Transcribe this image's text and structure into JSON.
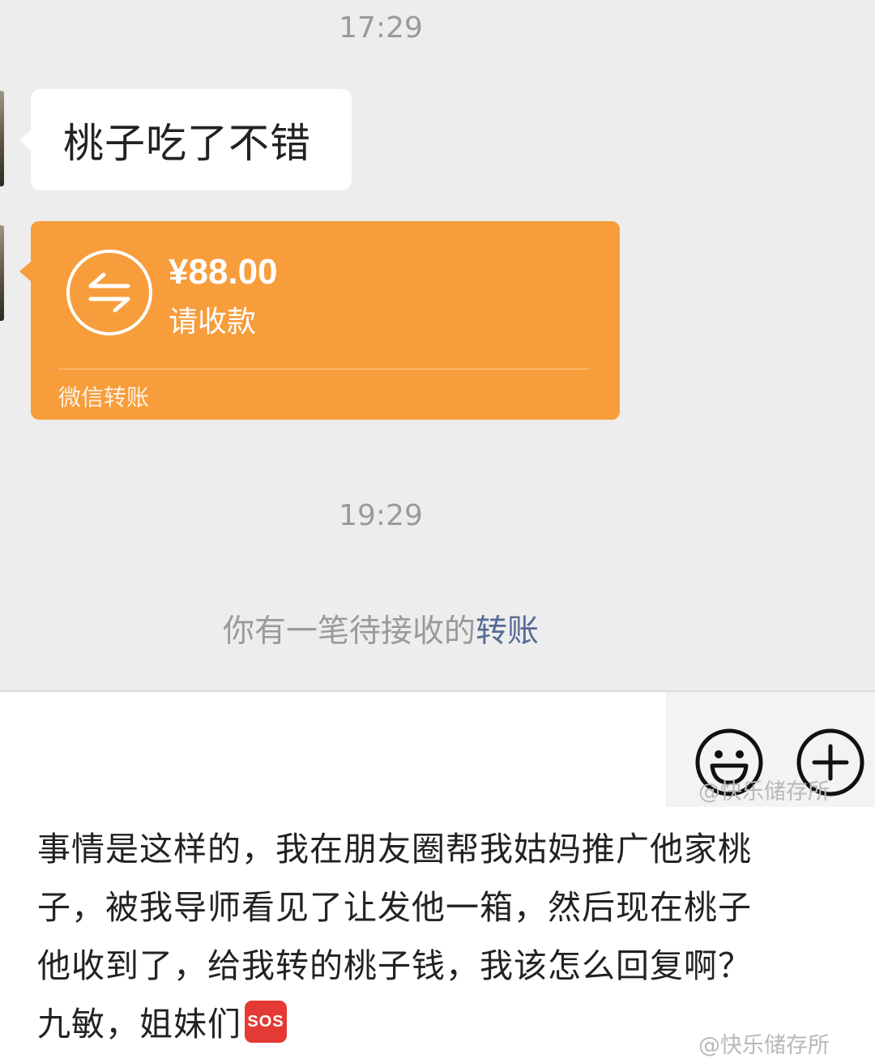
{
  "chat": {
    "timestamp_1": "17:29",
    "message_1": "桃子吃了不错",
    "transfer": {
      "amount": "¥88.00",
      "status": "请收款",
      "footer": "微信转账",
      "color": "#f79d3b"
    },
    "timestamp_2": "19:29",
    "notice_prefix": "你有一笔待接收的",
    "notice_link": "转账",
    "link_color": "#576b95"
  },
  "input_bar": {
    "emoji_icon": "smiley-face-icon",
    "plus_icon": "plus-circle-icon"
  },
  "watermark": "@快乐储存所",
  "caption": {
    "line_1": "事情是这样的，我在朋友圈帮我姑妈推广他家桃",
    "line_2": "子，被我导师看见了让发他一箱，然后现在桃子",
    "line_3": "他收到了，给我转的桃子钱，我该怎么回复啊？",
    "line_4": "九敏，姐妹们",
    "sos_emoji": "SOS"
  }
}
